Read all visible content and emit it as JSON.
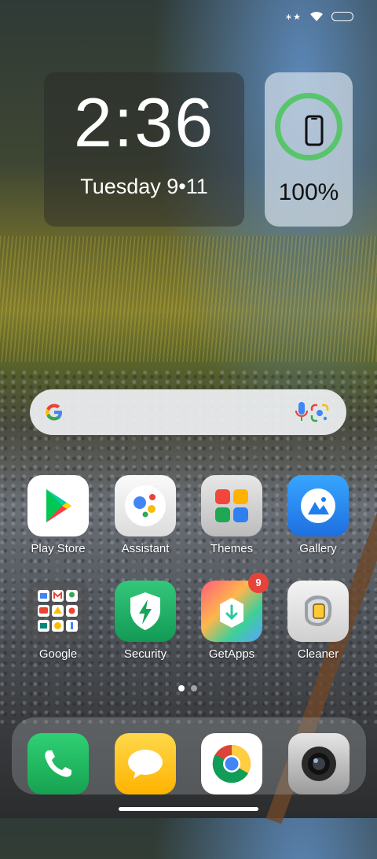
{
  "status_bar": {
    "notification_icons": "∗★",
    "wifi_icon": "wifi-icon",
    "battery_icon": "battery-icon"
  },
  "clock_widget": {
    "time": "2:36",
    "date": "Tuesday 9•11"
  },
  "battery_widget": {
    "percent": "100%",
    "level": 1.0,
    "ring_color": "#58c56a"
  },
  "search": {
    "icon": "google-g-icon",
    "mic_icon": "mic-icon",
    "lens_icon": "lens-icon"
  },
  "apps": [
    {
      "label": "Play Store",
      "icon": "play-store-icon"
    },
    {
      "label": "Assistant",
      "icon": "assistant-icon"
    },
    {
      "label": "Themes",
      "icon": "themes-icon"
    },
    {
      "label": "Gallery",
      "icon": "gallery-icon"
    },
    {
      "label": "Google",
      "icon": "google-folder-icon"
    },
    {
      "label": "Security",
      "icon": "security-icon"
    },
    {
      "label": "GetApps",
      "icon": "getapps-icon",
      "badge": "9"
    },
    {
      "label": "Cleaner",
      "icon": "cleaner-icon"
    }
  ],
  "page_indicator": {
    "pages": 2,
    "current": 1
  },
  "dock": [
    {
      "icon": "phone-icon"
    },
    {
      "icon": "messages-icon"
    },
    {
      "icon": "chrome-icon"
    },
    {
      "icon": "camera-icon"
    }
  ]
}
